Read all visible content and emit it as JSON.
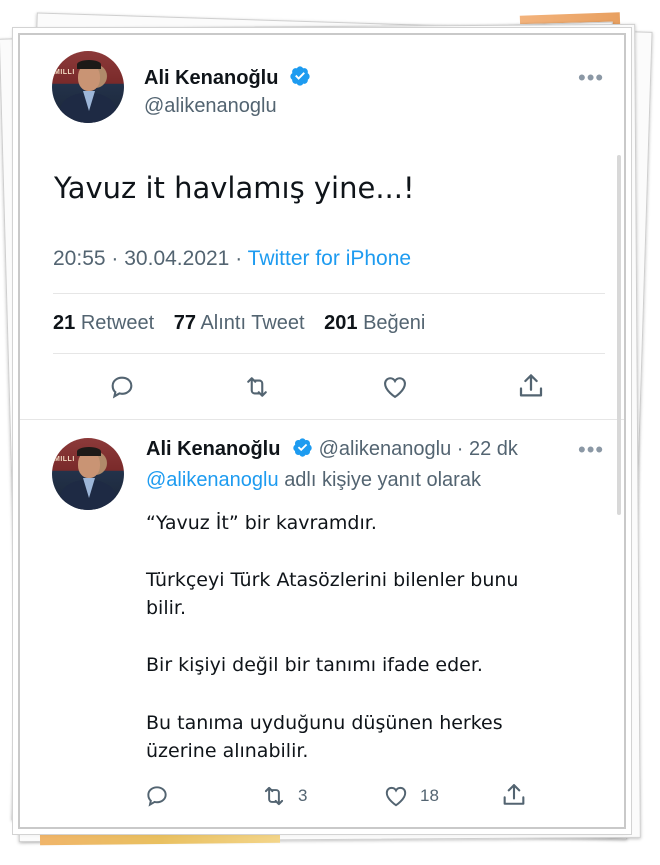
{
  "tweet": {
    "author_name": "Ali Kenanoğlu",
    "author_handle": "@alikenanoglu",
    "avatar_sign": "MILLI",
    "text": "Yavuz it havlamış yine...!",
    "time": "20:55",
    "separator": "·",
    "date": "30.04.2021",
    "source": "Twitter for iPhone",
    "stats": {
      "retweets_count": "21",
      "retweets_label": "Retweet",
      "quotes_count": "77",
      "quotes_label": "Alıntı Tweet",
      "likes_count": "201",
      "likes_label": "Beğeni"
    },
    "more_label": "•••"
  },
  "reply": {
    "author_name": "Ali Kenanoğlu",
    "author_handle": "@alikenanoglu",
    "time_ago": "22 dk",
    "separator": "·",
    "replying_to_mention": "@alikenanoglu",
    "replying_to_suffix": "adlı kişiye yanıt olarak",
    "paragraphs": [
      "“Yavuz İt” bir kavramdır.",
      "Türkçeyi Türk Atasözlerini bilenler bunu",
      "bilir.",
      "Bir kişiyi değil bir tanımı ifade eder.",
      "Bu tanıma uyduğunu düşünen herkes",
      "üzerine alınabilir."
    ],
    "retweet_count": "3",
    "like_count": "18",
    "more_label": "•••"
  },
  "icons": {
    "reply": "reply-icon",
    "retweet": "retweet-icon",
    "like": "heart-icon",
    "share": "share-icon",
    "verified": "verified-badge-icon",
    "more": "more-icon"
  },
  "colors": {
    "accent": "#1d9bf0",
    "secondary_text": "#536471",
    "primary_text": "#0f1419"
  }
}
